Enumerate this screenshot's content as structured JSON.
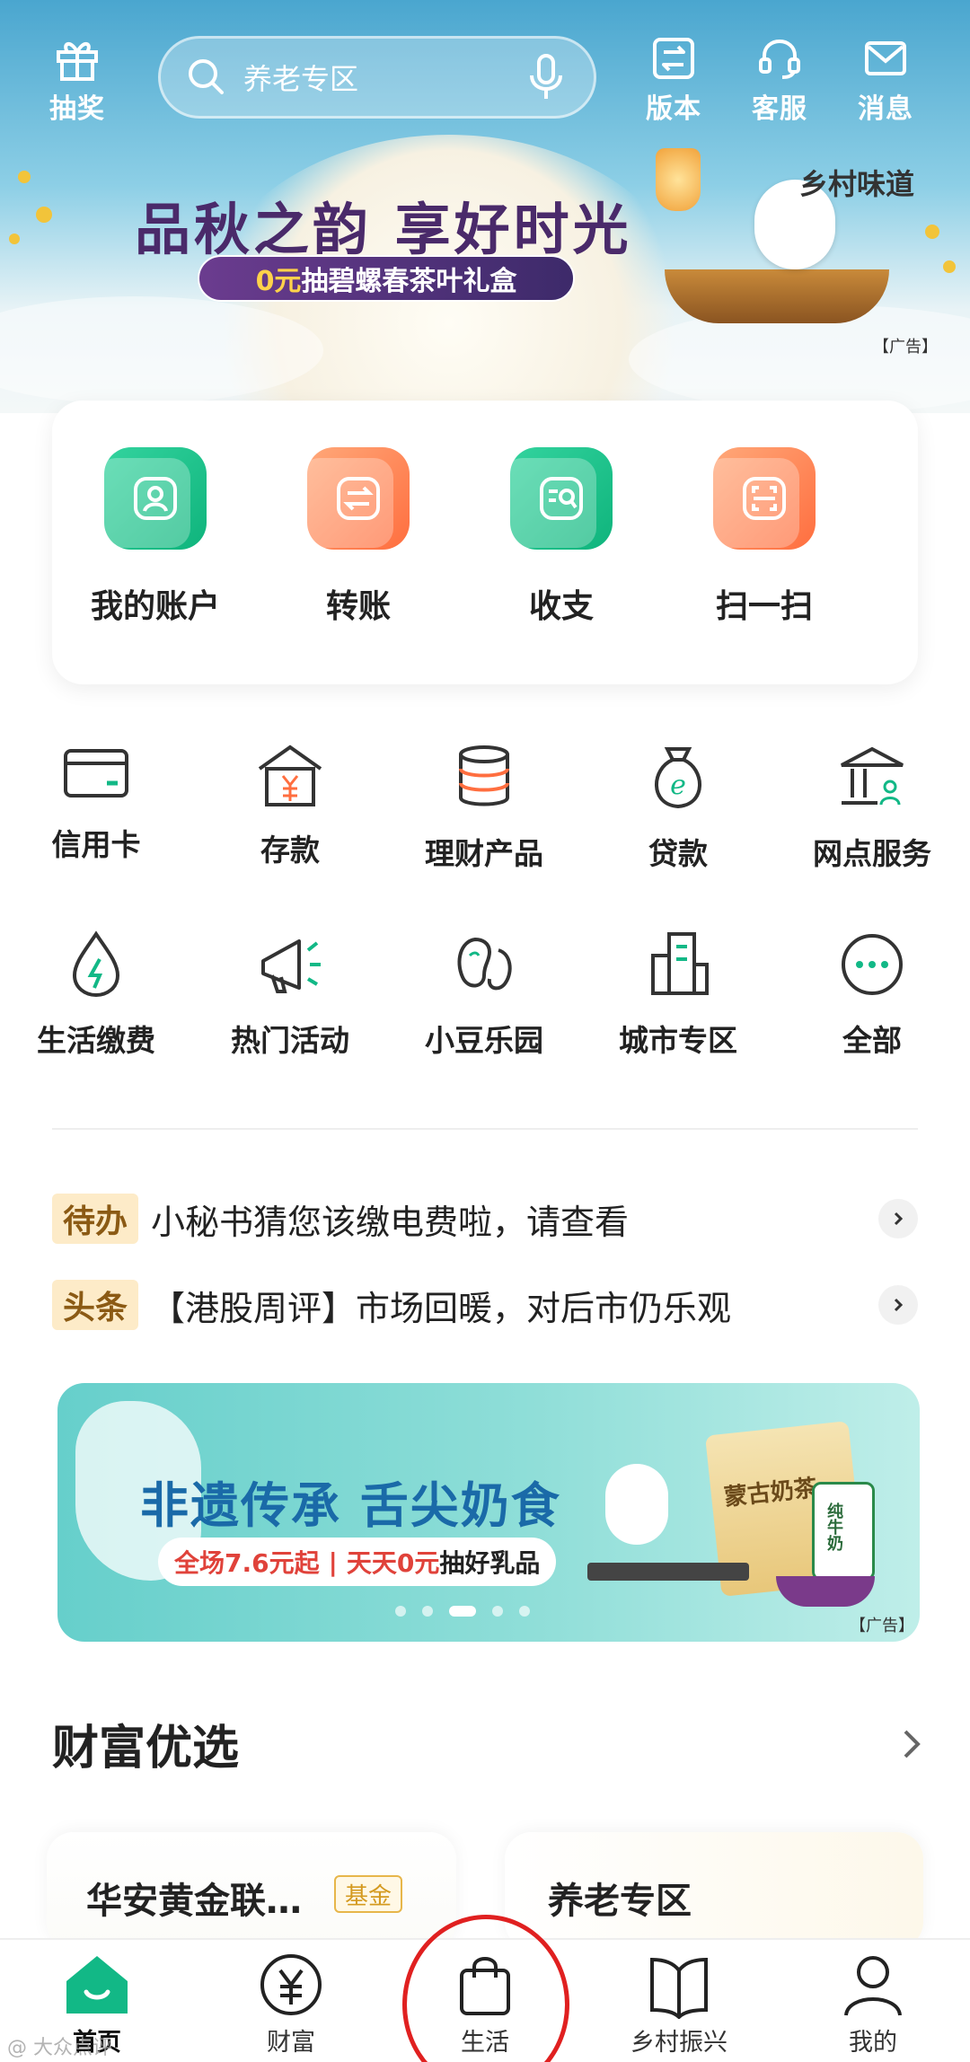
{
  "header": {
    "lottery": "抽奖",
    "search_placeholder": "养老专区",
    "version": "版本",
    "service": "客服",
    "message": "消息"
  },
  "top_banner": {
    "title": "品秋之韵 享好时光",
    "sub_zero": "0元",
    "sub_text": "抽碧螺春茶叶礼盒",
    "brand": "乡村味道",
    "ad": "【广告】"
  },
  "quick_actions": [
    {
      "label": "我的账户",
      "icon": "account-icon",
      "color": "green"
    },
    {
      "label": "转账",
      "icon": "transfer-icon",
      "color": "orange"
    },
    {
      "label": "收支",
      "icon": "income-expense-icon",
      "color": "green"
    },
    {
      "label": "扫一扫",
      "icon": "scan-icon",
      "color": "orange"
    }
  ],
  "services": [
    {
      "label": "信用卡",
      "icon": "credit-card-icon"
    },
    {
      "label": "存款",
      "icon": "deposit-icon"
    },
    {
      "label": "理财产品",
      "icon": "wealth-product-icon"
    },
    {
      "label": "贷款",
      "icon": "loan-icon"
    },
    {
      "label": "网点服务",
      "icon": "branch-service-icon"
    },
    {
      "label": "生活缴费",
      "icon": "utility-payment-icon"
    },
    {
      "label": "热门活动",
      "icon": "promotion-icon"
    },
    {
      "label": "小豆乐园",
      "icon": "bean-park-icon"
    },
    {
      "label": "城市专区",
      "icon": "city-zone-icon"
    },
    {
      "label": "全部",
      "icon": "more-icon"
    }
  ],
  "news": [
    {
      "tag": "待办",
      "text": "小秘书猜您该缴电费啦，请查看"
    },
    {
      "tag": "头条",
      "text": "【港股周评】市场回暖，对后市仍乐观"
    }
  ],
  "promo_banner": {
    "title": "非遗传承 舌尖奶食",
    "sub1": "全场7.6元起",
    "sub2_red": "天天0元",
    "sub2": "抽好乳品",
    "product_text": "蒙古奶茶",
    "product_text2": "纯牛奶",
    "ad": "【广告】",
    "dot_count": 5,
    "active_dot": 3
  },
  "wealth_section": {
    "title": "财富优选",
    "cards": [
      {
        "title": "华安黄金联…",
        "badge": "基金"
      },
      {
        "title": "养老专区"
      }
    ]
  },
  "tabbar": [
    {
      "label": "首页",
      "icon": "home-icon",
      "active": true
    },
    {
      "label": "财富",
      "icon": "wealth-icon",
      "active": false
    },
    {
      "label": "生活",
      "icon": "life-bag-icon",
      "active": false
    },
    {
      "label": "乡村振兴",
      "icon": "rural-book-icon",
      "active": false
    },
    {
      "label": "我的",
      "icon": "profile-icon",
      "active": false
    }
  ],
  "colors": {
    "brand_green": "#12b886",
    "accent_orange": "#ff7a45",
    "news_tag_bg": "#fdebc8",
    "highlight_circle": "#e02020"
  },
  "watermark": "@ 大众点评"
}
